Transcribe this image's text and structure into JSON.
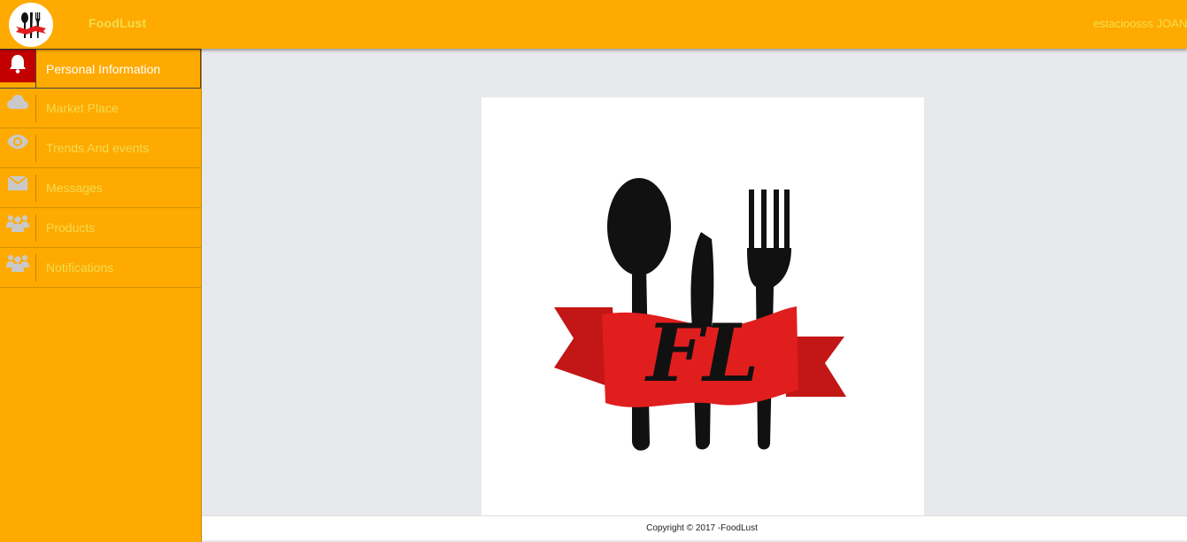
{
  "header": {
    "brand": "FoodLust",
    "user": "estacioosss JOAN",
    "logo_icon": "foodlust-logo-icon"
  },
  "sidebar": {
    "items": [
      {
        "label": "Personal Information",
        "icon": "bell-icon",
        "active": true
      },
      {
        "label": "Market Place",
        "icon": "cloud-icon",
        "active": false
      },
      {
        "label": "Trends And events",
        "icon": "eye-icon",
        "active": false
      },
      {
        "label": "Messages",
        "icon": "envelope-icon",
        "active": false
      },
      {
        "label": "Products",
        "icon": "users-icon",
        "active": false
      },
      {
        "label": "Notifications",
        "icon": "users-icon",
        "active": false
      }
    ]
  },
  "main": {
    "image": "foodlust-logo-image"
  },
  "footer": {
    "copyright": "Copyright © 2017 -FoodLust"
  },
  "colors": {
    "header_bg": "#ffaa00",
    "sidebar_bg": "#ffaa00",
    "active_icon_bg": "#c20000",
    "content_bg": "#e8e9ec",
    "ribbon_red": "#e01e1e"
  }
}
